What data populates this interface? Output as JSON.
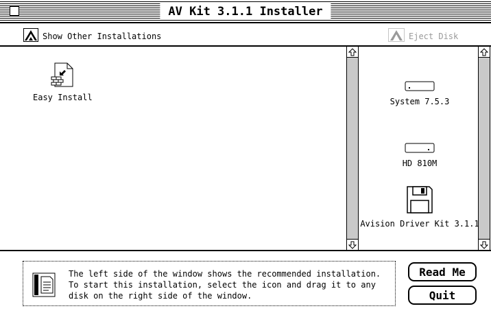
{
  "window": {
    "title": "AV Kit 3.1.1 Installer"
  },
  "toolbar": {
    "show_other": "Show Other Installations",
    "eject": "Eject Disk"
  },
  "left": {
    "items": [
      {
        "label": "Easy Install",
        "icon": "installer-doc-icon"
      }
    ]
  },
  "right": {
    "disks": [
      {
        "label": "System 7.5.3",
        "icon": "hard-disk-icon"
      },
      {
        "label": "HD 810M",
        "icon": "hard-disk-icon"
      },
      {
        "label": "Avision Driver Kit 3.1.1",
        "icon": "floppy-disk-icon"
      }
    ]
  },
  "help": {
    "text": "The left side of the window shows the recommended installation. To start this installation, select the icon and drag it to any disk on the right side of the window."
  },
  "buttons": {
    "read_me": "Read Me",
    "quit": "Quit"
  }
}
